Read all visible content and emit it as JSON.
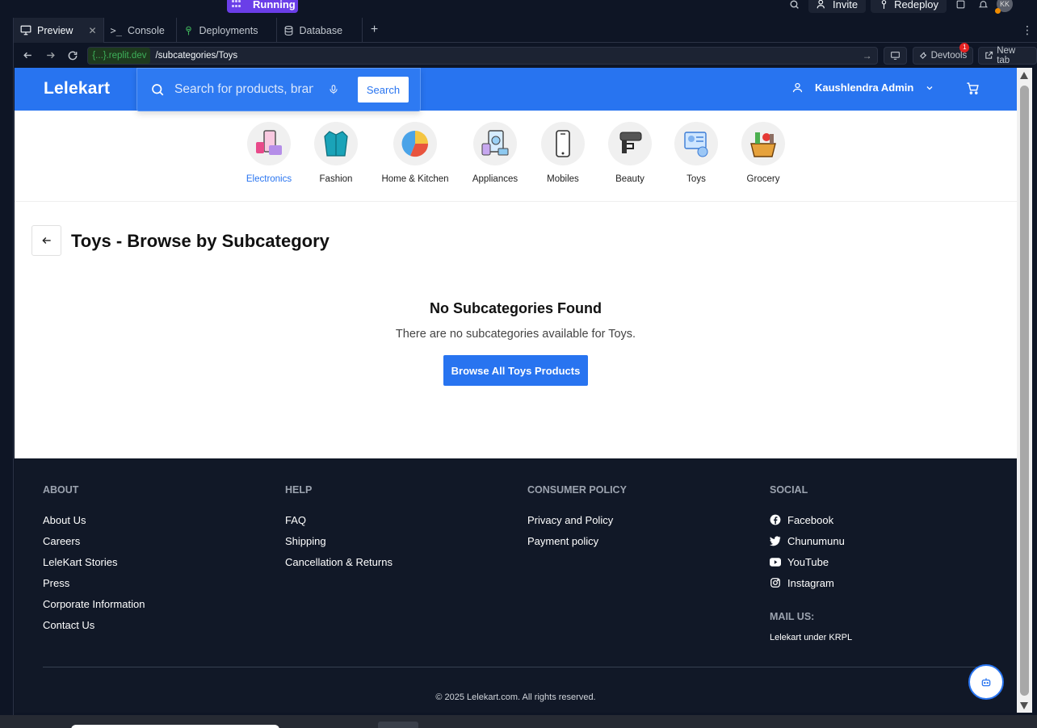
{
  "replit": {
    "run_status": "Running",
    "invite_label": "Invite",
    "redeploy_label": "Redeploy",
    "avatar_initials": "KK",
    "tabs": [
      {
        "label": "Preview",
        "icon": "monitor-icon",
        "active": true
      },
      {
        "label": "Console",
        "icon": "terminal-icon",
        "active": false
      },
      {
        "label": "Deployments",
        "icon": "deploy-icon",
        "active": false
      },
      {
        "label": "Database",
        "icon": "database-icon",
        "active": false
      }
    ],
    "url_host": "{...}.replit.dev",
    "url_path": "/subcategories/Toys",
    "devtools_label": "Devtools",
    "devtools_badge": "1",
    "new_tab_label": "New tab"
  },
  "site": {
    "logo": "Lelekart",
    "search_placeholder": "Search for products, brands and more",
    "search_button": "Search",
    "user_name": "Kaushlendra Admin",
    "brand_color": "#2874f0",
    "categories": [
      {
        "label": "Electronics",
        "icon": "electronics-icon",
        "active": true
      },
      {
        "label": "Fashion",
        "icon": "fashion-icon",
        "active": false
      },
      {
        "label": "Home & Kitchen",
        "icon": "home-kitchen-icon",
        "active": false
      },
      {
        "label": "Appliances",
        "icon": "appliances-icon",
        "active": false
      },
      {
        "label": "Mobiles",
        "icon": "mobile-icon",
        "active": false
      },
      {
        "label": "Beauty",
        "icon": "beauty-icon",
        "active": false
      },
      {
        "label": "Toys",
        "icon": "toys-icon",
        "active": false
      },
      {
        "label": "Grocery",
        "icon": "grocery-icon",
        "active": false
      }
    ],
    "page_title": "Toys - Browse by Subcategory",
    "empty_title": "No Subcategories Found",
    "empty_description": "There are no subcategories available for Toys.",
    "browse_button": "Browse All Toys Products"
  },
  "footer": {
    "about": {
      "heading": "ABOUT",
      "links": [
        "About Us",
        "Careers",
        "LeleKart Stories",
        "Press",
        "Corporate Information",
        "Contact Us"
      ]
    },
    "help": {
      "heading": "HELP",
      "links": [
        "FAQ",
        "Shipping",
        "Cancellation & Returns"
      ]
    },
    "policy": {
      "heading": "CONSUMER POLICY",
      "links": [
        "Privacy and Policy",
        "Payment policy"
      ]
    },
    "social": {
      "heading": "SOCIAL",
      "links": [
        "Facebook",
        "Chunumunu",
        "YouTube",
        "Instagram"
      ]
    },
    "mail_heading": "MAIL US:",
    "mail_text": "Lelekart under KRPL",
    "copyright": "© 2025 Lelekart.com. All rights reserved."
  }
}
